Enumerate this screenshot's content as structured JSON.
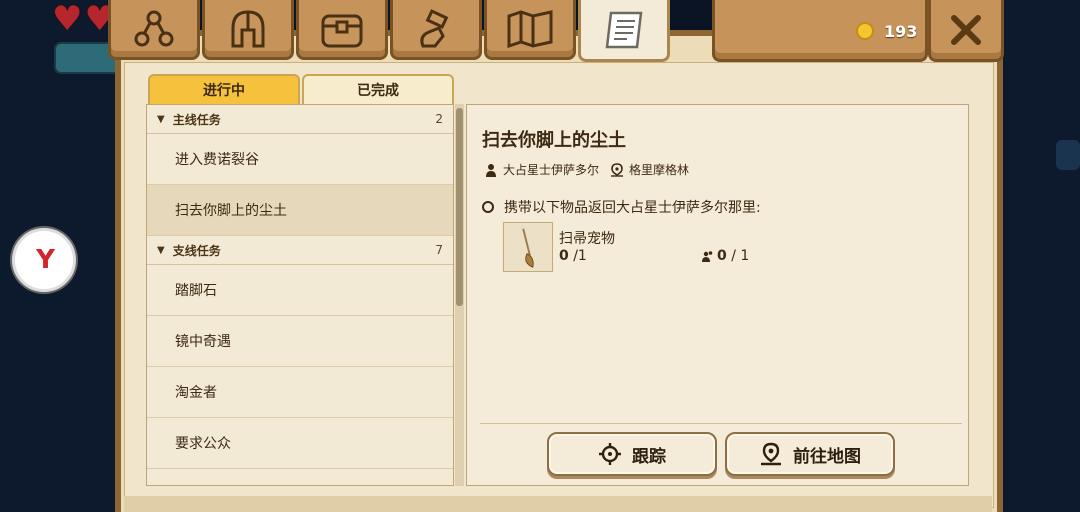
{
  "hud": {
    "gold": "193"
  },
  "tabs": [
    {
      "icon": "skill-tree-icon",
      "active": false
    },
    {
      "icon": "helmet-icon",
      "active": false
    },
    {
      "icon": "bag-icon",
      "active": false
    },
    {
      "icon": "crafting-icon",
      "active": false
    },
    {
      "icon": "map-icon",
      "active": false
    },
    {
      "icon": "quest-scroll-icon",
      "active": true
    }
  ],
  "subtabs": {
    "in_progress": "进行中",
    "completed": "已完成"
  },
  "quest_list": {
    "main_section": {
      "label": "主线任务",
      "count": "2"
    },
    "main_items": [
      "进入费诺裂谷",
      "扫去你脚上的尘土"
    ],
    "side_section": {
      "label": "支线任务",
      "count": "7"
    },
    "side_items": [
      "踏脚石",
      "镜中奇遇",
      "淘金者",
      "要求公众"
    ]
  },
  "detail": {
    "title": "扫去你脚上的尘土",
    "giver": "大占星士伊萨多尔",
    "location": "格里摩格林",
    "objective": "携带以下物品返回大占星士伊萨多尔那里:",
    "item": {
      "name": "扫帚宠物",
      "count": "0",
      "total": "/1",
      "party_count": "0",
      "party_total": "/ 1"
    },
    "buttons": {
      "track": "跟踪",
      "goto_map": "前往地图"
    }
  },
  "colors": {
    "accent": "#f6c23e",
    "wood": "#c6935a",
    "parchment": "#f1e6cc"
  }
}
